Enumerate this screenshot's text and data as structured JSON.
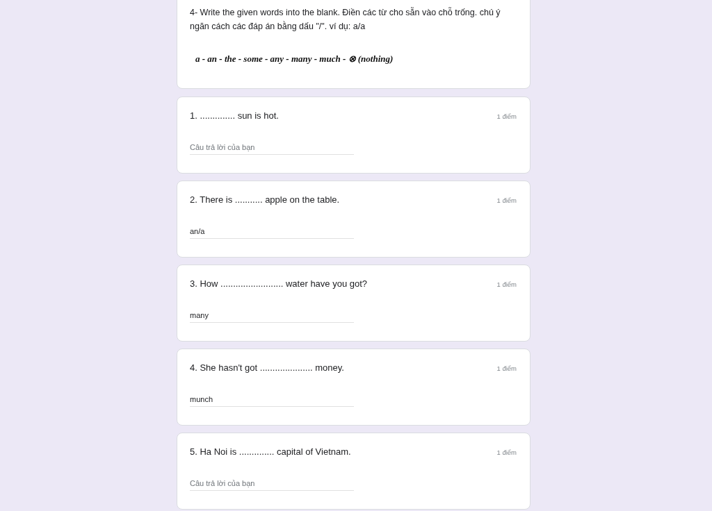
{
  "section": {
    "description": "4- Write the given words into the blank. Điền các từ cho sẵn vào chỗ trống. chú ý ngăn cách các đáp án bằng dấu \"/\". ví dụ: a/a",
    "word_bank": "a - an - the - some - any - many - much - ⊗ (nothing)"
  },
  "questions": [
    {
      "title": "1. .............. sun is hot.",
      "points": "1 điểm",
      "answer": {
        "placeholder": "Câu trả lời của bạn"
      }
    },
    {
      "title": "2. There is ........... apple on the table.",
      "points": "1 điểm",
      "answer": {
        "value": "an/a"
      }
    },
    {
      "title": "3. How ......................... water have you got?",
      "points": "1 điểm",
      "answer": {
        "value": "many"
      }
    },
    {
      "title": "4. She hasn't got ..................... money.",
      "points": "1 điểm",
      "answer": {
        "value": "munch"
      }
    },
    {
      "title": "5. Ha Noi is .............. capital of Vietnam.",
      "points": "1 điểm",
      "answer": {
        "placeholder": "Câu trả lời của bạn"
      }
    }
  ]
}
